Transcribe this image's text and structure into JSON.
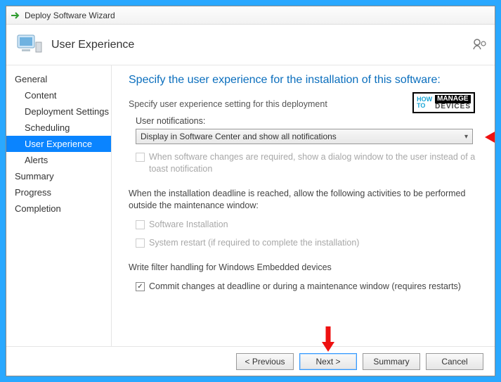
{
  "window": {
    "title": "Deploy Software Wizard"
  },
  "header": {
    "page_title": "User Experience"
  },
  "sidebar": {
    "items": [
      {
        "label": "General",
        "sub": false,
        "selected": false
      },
      {
        "label": "Content",
        "sub": true,
        "selected": false
      },
      {
        "label": "Deployment Settings",
        "sub": true,
        "selected": false
      },
      {
        "label": "Scheduling",
        "sub": true,
        "selected": false
      },
      {
        "label": "User Experience",
        "sub": true,
        "selected": true
      },
      {
        "label": "Alerts",
        "sub": true,
        "selected": false
      },
      {
        "label": "Summary",
        "sub": false,
        "selected": false
      },
      {
        "label": "Progress",
        "sub": false,
        "selected": false
      },
      {
        "label": "Completion",
        "sub": false,
        "selected": false
      }
    ]
  },
  "content": {
    "heading": "Specify the user experience for the installation of this software:",
    "section_label": "Specify user experience setting for this deployment",
    "user_notifications_label": "User notifications:",
    "user_notifications_value": "Display in Software Center and show all notifications",
    "dialog_checkbox_label": "When software changes are required, show a dialog window to the user instead of a toast notification",
    "deadline_heading": "When the installation deadline is reached, allow the following activities to be performed outside the maintenance window:",
    "software_install_label": "Software Installation",
    "system_restart_label": "System restart  (if required to complete the installation)",
    "write_filter_heading": "Write filter handling for Windows Embedded devices",
    "commit_checkbox_label": "Commit changes at deadline or during a maintenance window (requires restarts)"
  },
  "watermark": {
    "howto": "HOW\nTO",
    "manage": "MANAGE",
    "devices": "DEVICES"
  },
  "footer": {
    "previous": "<  Previous",
    "next": "Next  >",
    "summary": "Summary",
    "cancel": "Cancel"
  }
}
